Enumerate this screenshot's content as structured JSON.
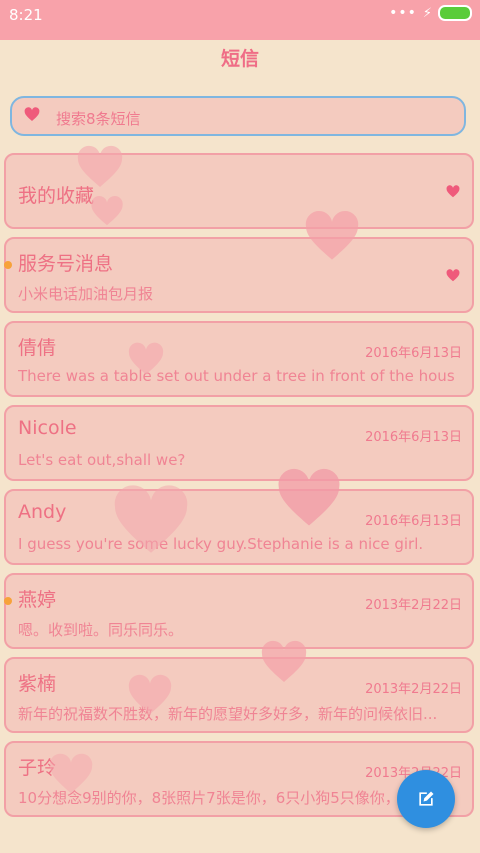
{
  "status": {
    "time": "8:21",
    "signal_dots": "•••",
    "charging": "⚡"
  },
  "header": {
    "title": "短信"
  },
  "search": {
    "placeholder": "搜索8条短信"
  },
  "favorites": {
    "label": "我的收藏"
  },
  "service": {
    "title": "服务号消息",
    "preview": "小米电话加油包月报",
    "unread": true
  },
  "threads": [
    {
      "name": "倩倩",
      "date": "2016年6月13日",
      "preview": "There was a table set out under a tree in front of the hous",
      "unread": false
    },
    {
      "name": "Nicole",
      "date": "2016年6月13日",
      "preview": "Let's eat out,shall we?",
      "unread": false
    },
    {
      "name": "Andy",
      "date": "2016年6月13日",
      "preview": "I guess you're some lucky guy.Stephanie is a nice girl.",
      "unread": false
    },
    {
      "name": "燕婷",
      "date": "2013年2月22日",
      "preview": "嗯。收到啦。同乐同乐。",
      "unread": true
    },
    {
      "name": "紫楠",
      "date": "2013年2月22日",
      "preview": "新年的祝福数不胜数，新年的愿望好多好多，新年的问候依旧...",
      "unread": false
    },
    {
      "name": "子玲",
      "date": "2013年2月22日",
      "preview": "10分想念9别的你，8张照片7张是你，6只小狗5只像你，4...",
      "unread": false
    }
  ],
  "colors": {
    "accent": "#ef6d86",
    "background": "#f5e4cc",
    "card": "#f4cbbf",
    "fab": "#2f8fe0"
  },
  "icons": {
    "search": "heart-icon",
    "compose": "compose-icon"
  }
}
